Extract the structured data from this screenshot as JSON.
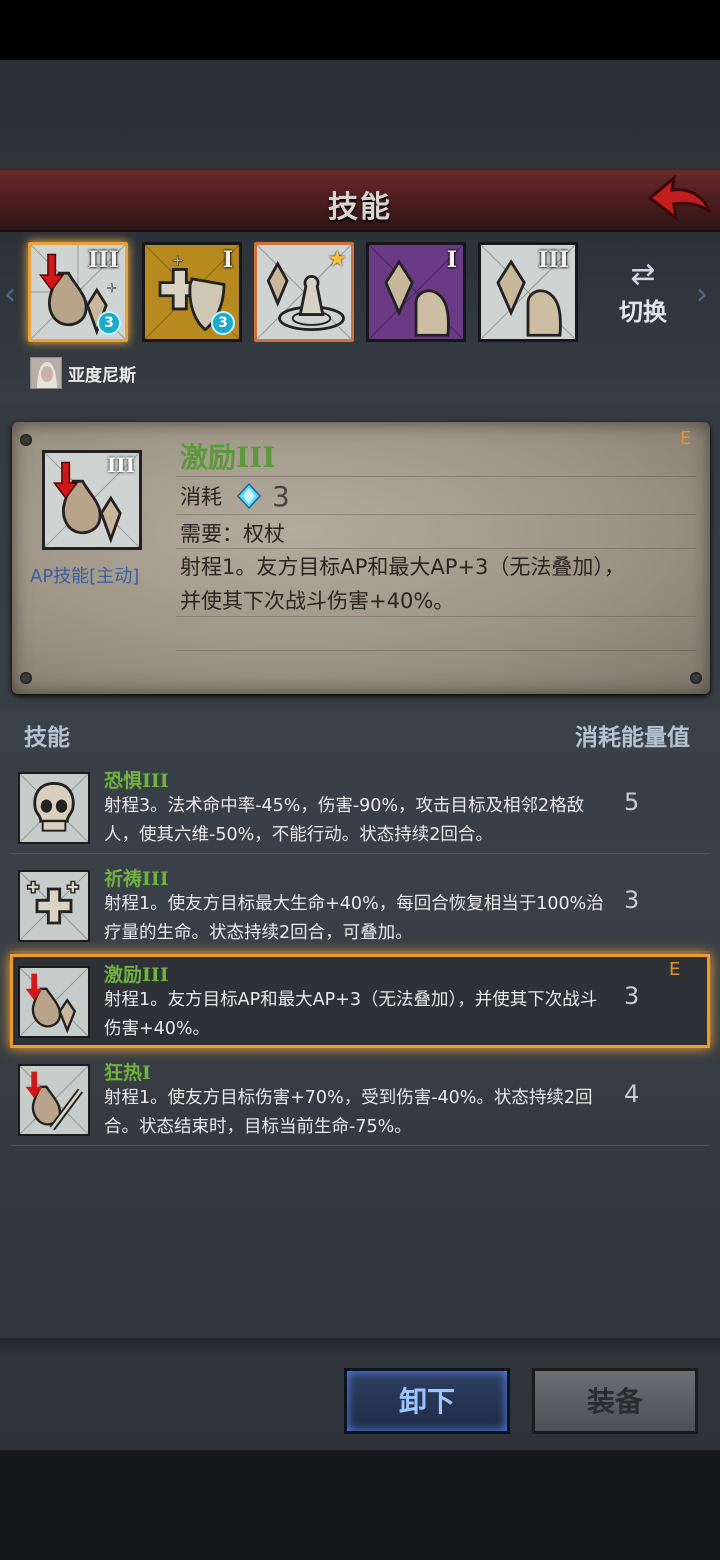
{
  "header": {
    "title": "技能"
  },
  "slots": [
    {
      "level": "III",
      "badge": "3"
    },
    {
      "level": "I",
      "badge": "3"
    },
    {
      "star": "★"
    },
    {
      "level": "I"
    },
    {
      "level": "III"
    }
  ],
  "switch": {
    "label": "切换"
  },
  "hero": {
    "name": "亚度尼斯"
  },
  "detail": {
    "level": "III",
    "name": "激励III",
    "tag": "E",
    "cost_label": "消耗",
    "cost_value": "3",
    "requirement": "需要：权杖",
    "description": "射程1。友方目标AP和最大AP+3（无法叠加），并使其下次战斗伤害+40%。",
    "type": "AP技能[主动]"
  },
  "list": {
    "header_left": "技能",
    "header_right": "消耗能量值",
    "skills": [
      {
        "name": "恐惧III",
        "desc": "射程3。法术命中率-45%，伤害-90%，攻击目标及相邻2格敌人，使其六维-50%，不能行动。状态持续2回合。",
        "cost": "5"
      },
      {
        "name": "祈祷III",
        "desc": "射程1。使友方目标最大生命+40%，每回合恢复相当于100%治疗量的生命。状态持续2回合，可叠加。",
        "cost": "3"
      },
      {
        "name": "激励III",
        "desc": "射程1。友方目标AP和最大AP+3（无法叠加），并使其下次战斗伤害+40%。",
        "cost": "3",
        "tag": "E"
      },
      {
        "name": "狂热I",
        "desc": "射程1。使友方目标伤害+70%，受到伤害-40%。状态持续2回合。状态结束时，目标当前生命-75%。",
        "cost": "4"
      }
    ]
  },
  "buttons": {
    "unequip": "卸下",
    "equip": "装备"
  },
  "colors": {
    "accent_orange": "#f09a2c",
    "skill_name_green": "#6fb23e",
    "header_red": "#6b2a2a"
  }
}
